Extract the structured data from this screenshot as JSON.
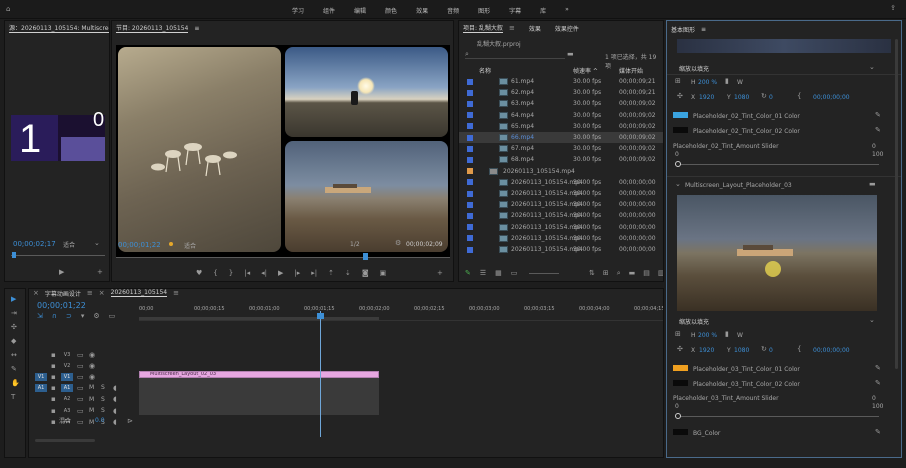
{
  "menu": {
    "items": [
      "学习",
      "组件",
      "编辑",
      "颜色",
      "效果",
      "音频",
      "图形",
      "字幕",
      "库"
    ],
    "more": "»"
  },
  "source": {
    "tab": "源：20260113_105154: Multiscree",
    "menu": "≡",
    "time": "00;00;02;17",
    "fit": "适合",
    "digit": "1",
    "digit2": "0"
  },
  "program": {
    "tab": "节目: 20260113_105154",
    "menu": "≡",
    "time": "00;00;01;22",
    "fit": "适合",
    "page": "1/2",
    "duration": "00;00;02;09"
  },
  "project": {
    "tabs": [
      "项目: 乱糊大叙",
      "效果",
      "效果控件"
    ],
    "file": "乱糊大叙.prproj",
    "selection": "1 项已选择，共 19 项",
    "cols": [
      "名称",
      "帧速率 ^",
      "媒体开始"
    ],
    "rows": [
      {
        "name": "61.mp4",
        "fps": "30.00 fps",
        "start": "00;00;09;21"
      },
      {
        "name": "62.mp4",
        "fps": "30.00 fps",
        "start": "00;00;09;21"
      },
      {
        "name": "63.mp4",
        "fps": "30.00 fps",
        "start": "00;00;09;02"
      },
      {
        "name": "64.mp4",
        "fps": "30.00 fps",
        "start": "00;00;09;02"
      },
      {
        "name": "65.mp4",
        "fps": "30.00 fps",
        "start": "00;00;09;02"
      },
      {
        "name": "66.mp4",
        "fps": "30.00 fps",
        "start": "00;00;09;02"
      },
      {
        "name": "67.mp4",
        "fps": "30.00 fps",
        "start": "00;00;09;02"
      },
      {
        "name": "68.mp4",
        "fps": "30.00 fps",
        "start": "00;00;09;02"
      },
      {
        "name": "20260113_105154.mp4",
        "fps": "",
        "start": ""
      },
      {
        "name": "20260113_105154.mp4",
        "fps": "30.00 fps",
        "start": "00;00;00;00"
      },
      {
        "name": "20260113_105154.mp4",
        "fps": "30.00 fps",
        "start": "00;00;00;00"
      },
      {
        "name": "20260113_105154.mp4",
        "fps": "30.00 fps",
        "start": "00;00;00;00"
      },
      {
        "name": "20260113_105154.mp4",
        "fps": "30.00 fps",
        "start": "00;00;00;00"
      },
      {
        "name": "20260113_105154.mp4",
        "fps": "30.00 fps",
        "start": "00;00;00;00"
      },
      {
        "name": "20260113_105154.mp4",
        "fps": "30.00 fps",
        "start": "00;00;00;00"
      },
      {
        "name": "20260113_105154.mp4",
        "fps": "30.00 fps",
        "start": "00;00;00;00"
      }
    ]
  },
  "timeline": {
    "tabs": [
      "字幕动画设计",
      "20260113_105154"
    ],
    "time": "00;00;01;22",
    "ruler": [
      "00;00",
      "00;00;00;15",
      "00;00;01;00",
      "00;00;01;15",
      "00;00;02;00",
      "00;00;02;15",
      "00;00;03;00",
      "00;00;03;15",
      "00;00;04;00",
      "00;00;04;15"
    ],
    "tracks_v": [
      "V3",
      "V2",
      "V1"
    ],
    "tracks_a": [
      "A1",
      "A2",
      "A3",
      "A4"
    ],
    "v1": "V1",
    "a1": "A1",
    "mix": "混合",
    "mix_val": "0.0",
    "clip": "Multiscreen_Layout_02_03",
    "m": "M",
    "s": "S"
  },
  "graphics": {
    "title": "基本图形",
    "menu": "≡",
    "scale_fill1": "缩放以填充",
    "h1": "200 %",
    "w1": "W",
    "x1": "1920",
    "y1": "1080",
    "r1": "0",
    "t1": "00;00;00;00",
    "c1": "Placeholder_02_Tint_Color_01 Color",
    "c2": "Placeholder_02_Tint_Color_02 Color",
    "slider1": "Placeholder_02_Tint_Amount Slider",
    "s1min": "0",
    "s1max": "100",
    "s1v": "0",
    "group": "Multiscreen_Layout_Placeholder_03",
    "scale_fill2": "缩放以填充",
    "h2": "200 %",
    "w2": "W",
    "x2": "1920",
    "y2": "1080",
    "r2": "0",
    "t2": "00;00;00;00",
    "c3": "Placeholder_03_Tint_Color_01 Color",
    "c4": "Placeholder_03_Tint_Color_02 Color",
    "slider2": "Placeholder_03_Tint_Amount Slider",
    "s2min": "0",
    "s2max": "100",
    "s2v": "0",
    "bg": "BG_Color",
    "colors": {
      "c1": "#3aa3e0",
      "c2": "#0a0a0a",
      "c3": "#f0a020",
      "c4": "#0a0a0a",
      "bg": "#0a0a0a"
    }
  }
}
